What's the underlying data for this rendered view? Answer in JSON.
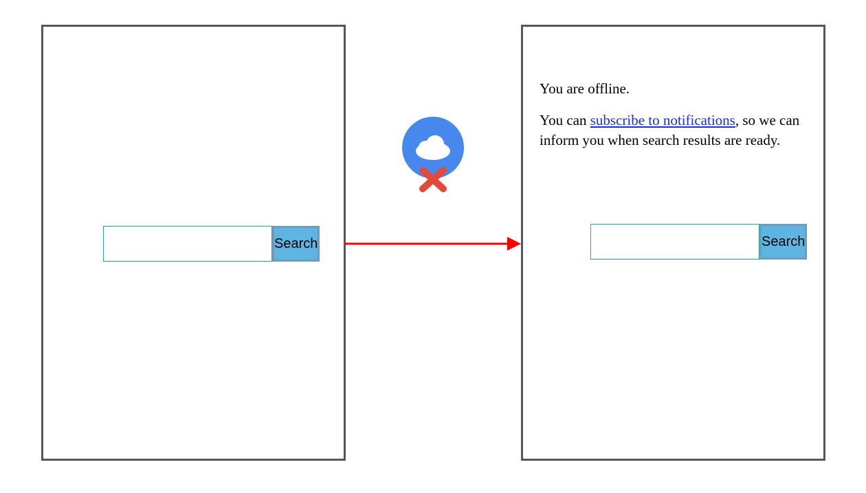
{
  "left": {
    "search": {
      "value": "",
      "button_label": "Search"
    }
  },
  "right": {
    "offline": {
      "line1": "You are offline.",
      "line2_pre": "You can ",
      "link_text": "subscribe to notifications",
      "line2_post": ", so we can inform you when search results are ready."
    },
    "search": {
      "value": "",
      "button_label": "Search"
    }
  },
  "icons": {
    "cloud_offline": "cloud-offline",
    "arrow": "transition-arrow"
  },
  "colors": {
    "panel_border": "#575757",
    "input_border": "#1caa9b",
    "button_fill": "#5fb5e1",
    "button_border": "#6e9cbe",
    "cloud_circle": "#4688ee",
    "cloud_fill": "#ffffff",
    "cross": "#e74c3c",
    "arrow_color": "#ff0000",
    "link": "#1a2be8"
  }
}
